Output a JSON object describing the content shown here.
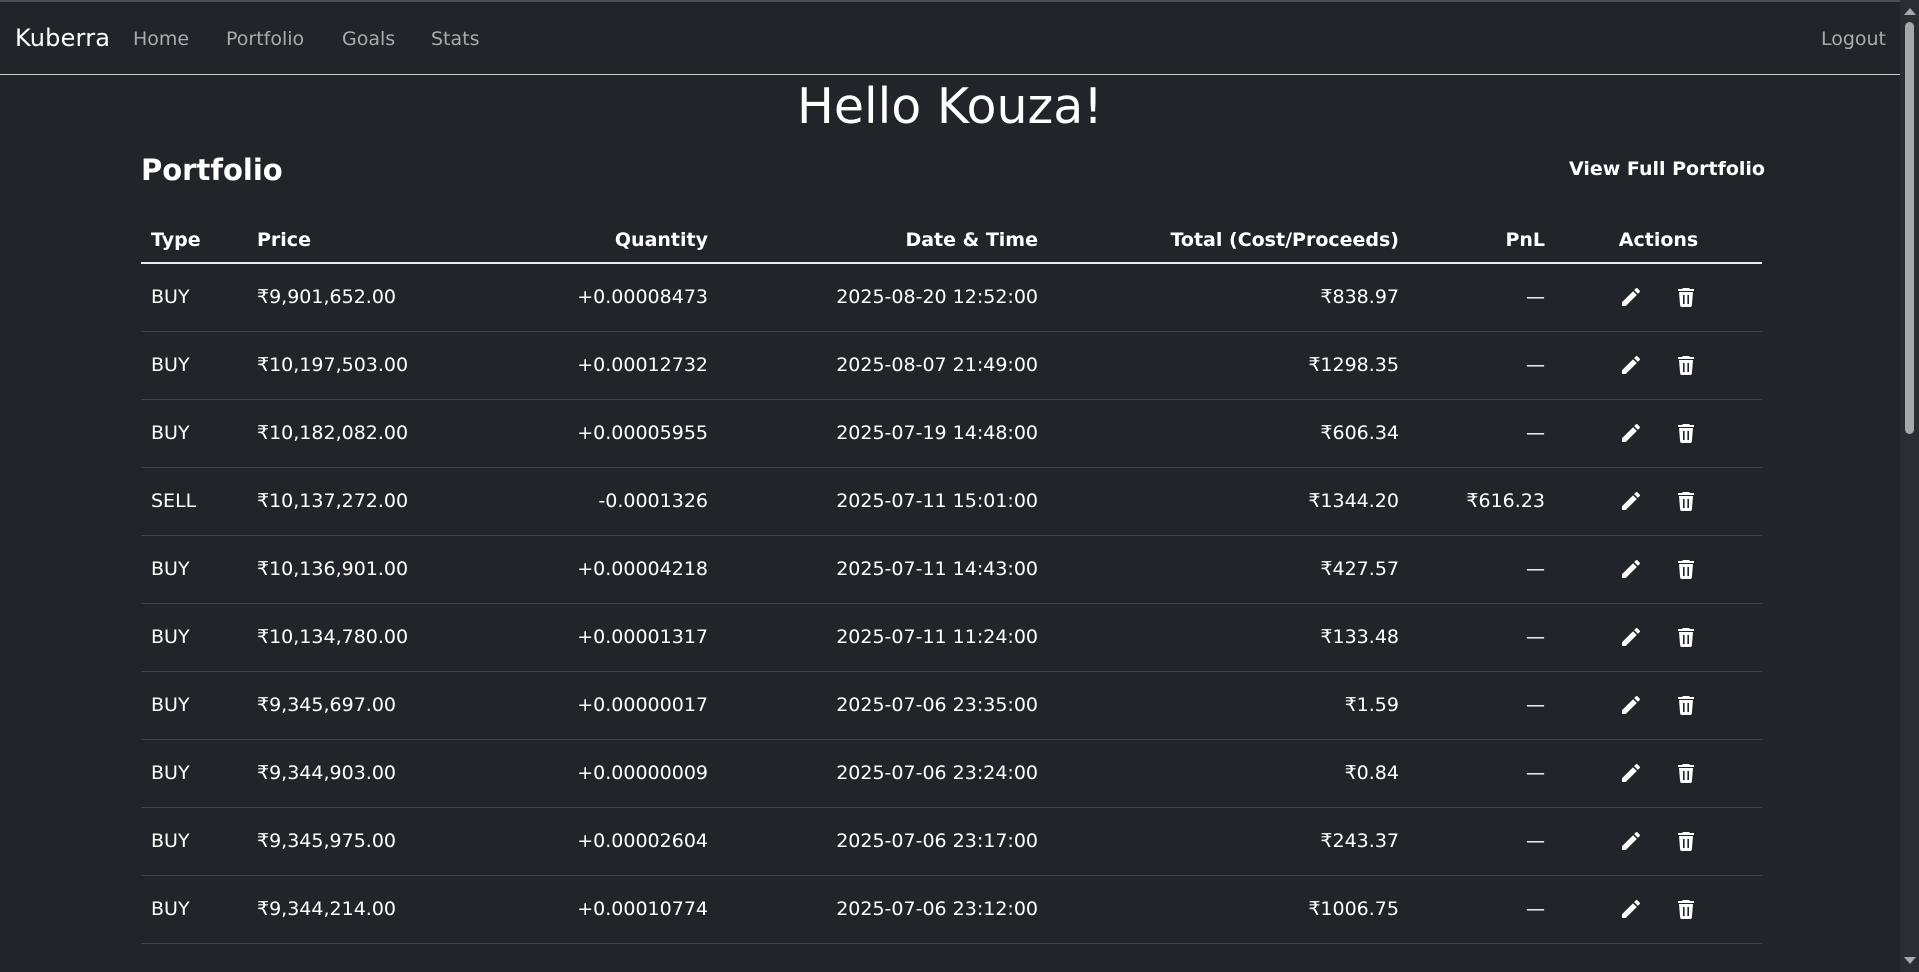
{
  "nav": {
    "brand": "Kuberra",
    "links": [
      "Home",
      "Portfolio",
      "Goals",
      "Stats"
    ],
    "logout": "Logout"
  },
  "greeting": "Hello Kouza!",
  "portfolio": {
    "title": "Portfolio",
    "view_full": "View Full Portfolio",
    "headers": [
      "Type",
      "Price",
      "Quantity",
      "Date & Time",
      "Total (Cost/Proceeds)",
      "PnL",
      "Actions"
    ],
    "rows": [
      {
        "type": "BUY",
        "price": "₹9,901,652.00",
        "quantity": "+0.00008473",
        "datetime": "2025-08-20 12:52:00",
        "total": "₹838.97",
        "pnl": "—"
      },
      {
        "type": "BUY",
        "price": "₹10,197,503.00",
        "quantity": "+0.00012732",
        "datetime": "2025-08-07 21:49:00",
        "total": "₹1298.35",
        "pnl": "—"
      },
      {
        "type": "BUY",
        "price": "₹10,182,082.00",
        "quantity": "+0.00005955",
        "datetime": "2025-07-19 14:48:00",
        "total": "₹606.34",
        "pnl": "—"
      },
      {
        "type": "SELL",
        "price": "₹10,137,272.00",
        "quantity": "-0.0001326",
        "datetime": "2025-07-11 15:01:00",
        "total": "₹1344.20",
        "pnl": "₹616.23"
      },
      {
        "type": "BUY",
        "price": "₹10,136,901.00",
        "quantity": "+0.00004218",
        "datetime": "2025-07-11 14:43:00",
        "total": "₹427.57",
        "pnl": "—"
      },
      {
        "type": "BUY",
        "price": "₹10,134,780.00",
        "quantity": "+0.00001317",
        "datetime": "2025-07-11 11:24:00",
        "total": "₹133.48",
        "pnl": "—"
      },
      {
        "type": "BUY",
        "price": "₹9,345,697.00",
        "quantity": "+0.00000017",
        "datetime": "2025-07-06 23:35:00",
        "total": "₹1.59",
        "pnl": "—"
      },
      {
        "type": "BUY",
        "price": "₹9,344,903.00",
        "quantity": "+0.00000009",
        "datetime": "2025-07-06 23:24:00",
        "total": "₹0.84",
        "pnl": "—"
      },
      {
        "type": "BUY",
        "price": "₹9,345,975.00",
        "quantity": "+0.00002604",
        "datetime": "2025-07-06 23:17:00",
        "total": "₹243.37",
        "pnl": "—"
      },
      {
        "type": "BUY",
        "price": "₹9,344,214.00",
        "quantity": "+0.00010774",
        "datetime": "2025-07-06 23:12:00",
        "total": "₹1006.75",
        "pnl": "—"
      }
    ]
  },
  "colors": {
    "background": "#212529",
    "buy": "#2e8b57",
    "sell": "#dc3545"
  },
  "icons": {
    "edit": "pencil-icon",
    "delete": "trash-icon"
  }
}
